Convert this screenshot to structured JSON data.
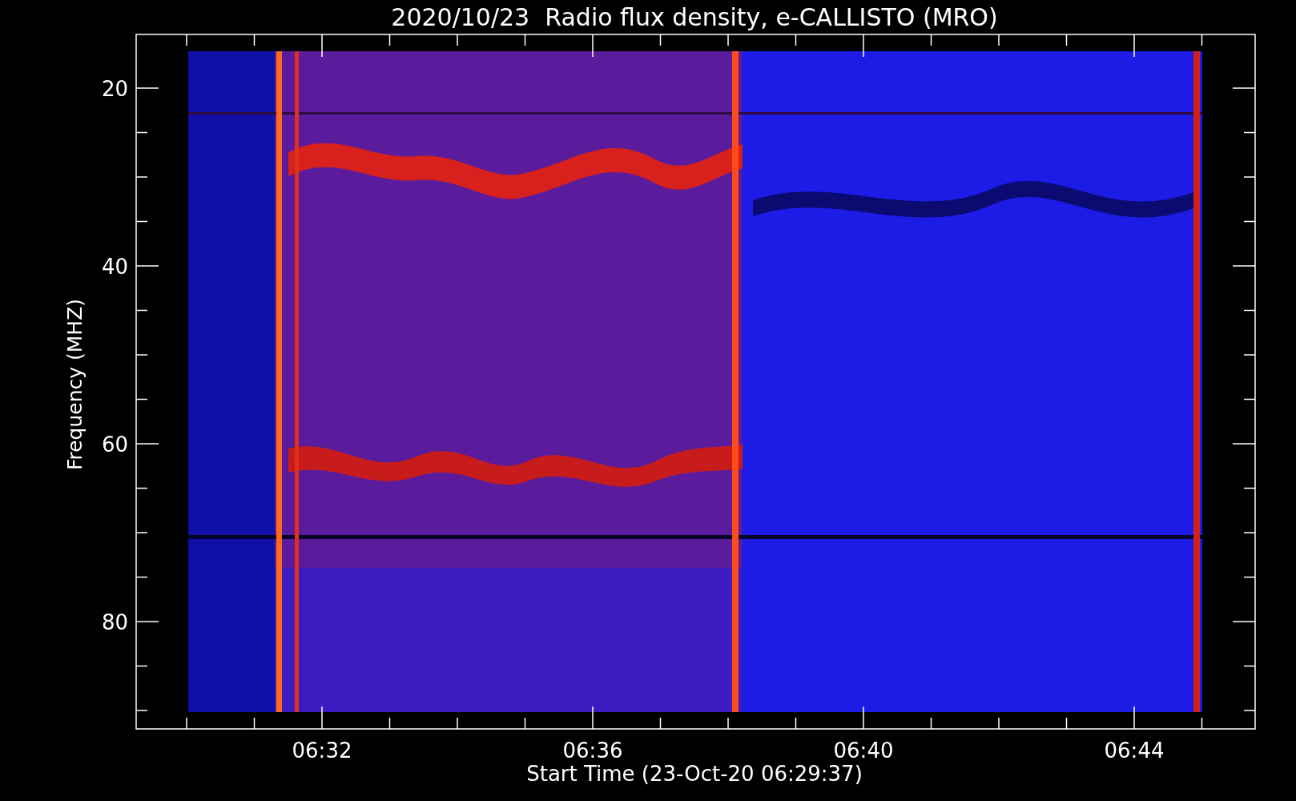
{
  "title": "2020/10/23  Radio flux density, e-CALLISTO (MRO)",
  "yaxis": {
    "label": "Frequency (MHZ)",
    "ticks": [
      "20",
      "40",
      "60",
      "80"
    ]
  },
  "xaxis": {
    "label": "Start Time (23-Oct-20 06:29:37)",
    "ticks": [
      "06:32",
      "06:36",
      "06:40",
      "06:44"
    ]
  }
}
